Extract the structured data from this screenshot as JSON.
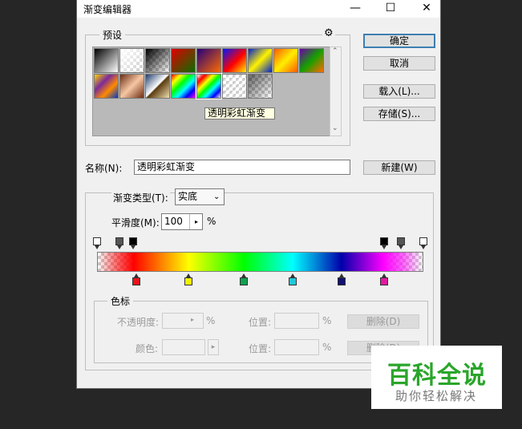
{
  "window": {
    "title": "渐变编辑器",
    "minimize": "—",
    "maximize": "☐",
    "close": "✕"
  },
  "presets": {
    "legend": "预设",
    "gear": "⚙",
    "swatches": [
      {
        "name": "black-white",
        "css": "linear-gradient(135deg,#000 0%,#fff 100%)"
      },
      {
        "name": "white-transparent",
        "css": "linear-gradient(135deg,#fff 0%,rgba(255,255,255,0) 100%)"
      },
      {
        "name": "black-transparent",
        "css": "linear-gradient(135deg,#000 0%,rgba(0,0,0,0) 100%)"
      },
      {
        "name": "red-green",
        "css": "linear-gradient(135deg,#e00000 0%,#0a6e00 100%)"
      },
      {
        "name": "violet-orange",
        "css": "linear-gradient(135deg,#25007a 0%,#ff6a00 100%)"
      },
      {
        "name": "blue-red-yellow",
        "css": "linear-gradient(135deg,#0018ff 0%,#ff0000 55%,#ffee00 100%)"
      },
      {
        "name": "blue-yellow-blue",
        "css": "linear-gradient(135deg,#0022cc 0%,#fff200 50%,#0022cc 100%)"
      },
      {
        "name": "orange-yellow-orange",
        "css": "linear-gradient(135deg,#ff5a00 0%,#ffee00 50%,#ff5a00 100%)"
      },
      {
        "name": "violet-green-orange",
        "css": "linear-gradient(135deg,#6a00a8 0%,#14a000 50%,#ff6a00 100%)"
      },
      {
        "name": "yellow-violet-orange-blue",
        "css": "linear-gradient(135deg,#ffd400 0%,#7b2a9a 35%,#ff8a00 65%,#0038c8 100%)"
      },
      {
        "name": "copper",
        "css": "linear-gradient(135deg,#6b2c12 0%,#f7c7a4 50%,#6b2c12 100%)"
      },
      {
        "name": "chrome",
        "css": "linear-gradient(135deg,#1f3c6a 0%,#ffffff 48%,#5a3a10 52%,#f0e0b0 100%)"
      },
      {
        "name": "spectrum",
        "css": "linear-gradient(135deg,#ff0000,#ffff00,#00ff00,#00ffff,#0000ff,#ff00ff)"
      },
      {
        "name": "transparent-rainbow",
        "css": "linear-gradient(135deg,rgba(255,0,0,0) 0%,#ff0000 18%,#ffff00 35%,#00ff00 50%,#00ffff 65%,#0000ff 82%,rgba(255,0,255,0) 100%)"
      },
      {
        "name": "transparent-stripes",
        "css": "repeating-linear-gradient(135deg,rgba(255,255,255,0.6) 0 3px,rgba(255,255,255,0) 3px 6px)"
      },
      {
        "name": "neutral-density",
        "css": "linear-gradient(135deg,rgba(0,0,0,0.6) 0%,rgba(0,0,0,0) 100%)"
      }
    ],
    "tooltip": "透明彩虹渐变"
  },
  "buttons": {
    "ok": "确定",
    "cancel": "取消",
    "load": "载入(L)...",
    "save": "存储(S)...",
    "new": "新建(W)"
  },
  "name_field": {
    "label": "名称(N):",
    "value": "透明彩虹渐变"
  },
  "gradient": {
    "type_label": "渐变类型(T):",
    "type_value": "实底",
    "smooth_label": "平滑度(M):",
    "smooth_value": "100",
    "smooth_unit": "%",
    "bar_css": "linear-gradient(to right,rgba(255,0,0,0) 0%,rgba(255,0,0,0.6) 6%,#ff0000 11%,#ffff00 28%,#00ff00 45%,#00ffff 60%,#0000aa 75%,#ff00ff 88%,rgba(255,0,255,0.6) 94%,rgba(255,0,255,0) 100%)",
    "opacity_stops": [
      {
        "pos": 0.0,
        "color": "#ffffff"
      },
      {
        "pos": 0.07,
        "color": "#555555"
      },
      {
        "pos": 0.11,
        "color": "#000000"
      },
      {
        "pos": 0.88,
        "color": "#000000"
      },
      {
        "pos": 0.93,
        "color": "#555555"
      },
      {
        "pos": 1.0,
        "color": "#ffffff"
      }
    ],
    "color_stops": [
      {
        "pos": 0.12,
        "color": "#e8141c"
      },
      {
        "pos": 0.28,
        "color": "#f2f200"
      },
      {
        "pos": 0.45,
        "color": "#10a050"
      },
      {
        "pos": 0.6,
        "color": "#20c8d8"
      },
      {
        "pos": 0.75,
        "color": "#101070"
      },
      {
        "pos": 0.88,
        "color": "#e01aa0"
      }
    ]
  },
  "stops_group": {
    "legend": "色标",
    "opacity_label": "不透明度:",
    "opacity_unit": "%",
    "position_label_1": "位置:",
    "position_unit_1": "%",
    "delete_1": "删除(D)",
    "color_label": "颜色:",
    "position_label_2": "位置:",
    "position_unit_2": "%",
    "delete_2": "删除(D)"
  },
  "watermark": {
    "title": "百科全说",
    "subtitle": "助你轻松解决"
  }
}
